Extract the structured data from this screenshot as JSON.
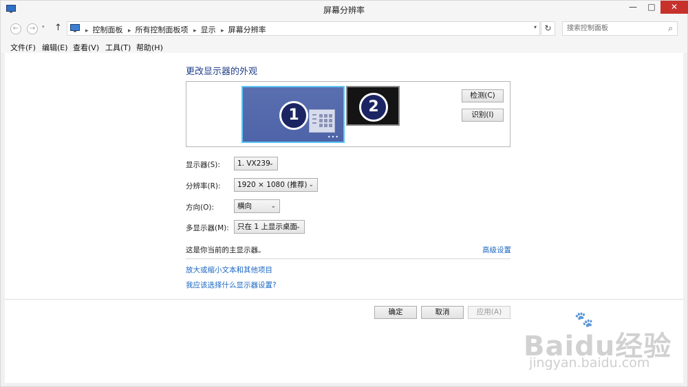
{
  "window": {
    "title": "屏幕分辨率",
    "min_glyph": "—",
    "max_glyph": "□",
    "close_glyph": "✕"
  },
  "nav": {
    "back_glyph": "←",
    "forward_glyph": "→",
    "recent_glyph": "▾",
    "up_glyph": "↑",
    "breadcrumbs": [
      "控制面板",
      "所有控制面板项",
      "显示",
      "屏幕分辨率"
    ],
    "crumb_sep": "▸",
    "dropdown_glyph": "▾",
    "refresh_glyph": "↻",
    "search_placeholder": "搜索控制面板",
    "search_glyph": "⌕"
  },
  "menu": [
    "文件(F)",
    "编辑(E)",
    "查看(V)",
    "工具(T)",
    "帮助(H)"
  ],
  "main": {
    "title": "更改显示器的外观",
    "monitors": [
      {
        "number": "1",
        "selected": true
      },
      {
        "number": "2",
        "selected": false
      }
    ],
    "monitor_dots": "•••",
    "detect_label": "检测(C)",
    "identify_label": "识别(I)",
    "settings": {
      "display_label": "显示器(S):",
      "display_value": "1. VX239",
      "resolution_label": "分辨率(R):",
      "resolution_value": "1920 × 1080 (推荐)",
      "orientation_label": "方向(O):",
      "orientation_value": "横向",
      "multi_label": "多显示器(M):",
      "multi_value": "只在 1 上显示桌面",
      "chevron_glyph": "⌄"
    },
    "status_text": "这是你当前的主显示器。",
    "advanced_link": "高级设置",
    "link_zoom": "放大或缩小文本和其他项目",
    "link_which": "我应该选择什么显示器设置?"
  },
  "footer": {
    "ok_label": "确定",
    "cancel_label": "取消",
    "apply_label": "应用(A)"
  },
  "watermark": {
    "logo": "Baidu经验",
    "url": "jingyan.baidu.com",
    "paw": "🐾"
  },
  "colors": {
    "accent_title": "#1f3d89",
    "link": "#1a66c2",
    "close_button": "#c7312c",
    "monitor_selected_border": "#5ec6f5",
    "monitor_1_bg": "#5a6faf",
    "monitor_2_bg": "#141414"
  }
}
